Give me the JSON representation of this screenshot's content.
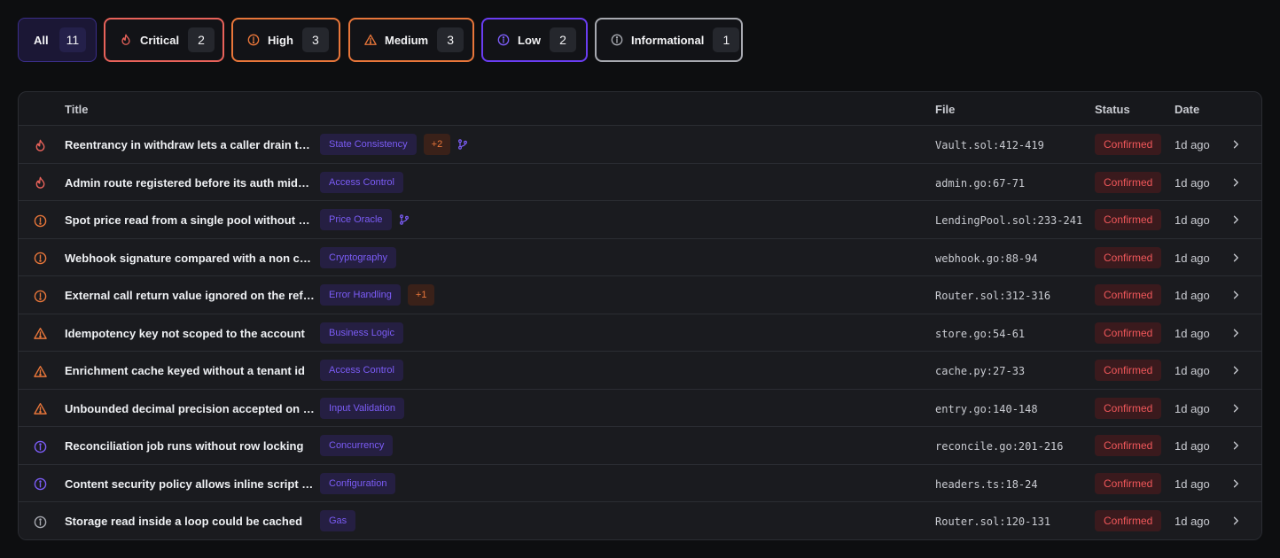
{
  "filters": {
    "all": {
      "label": "All",
      "count": "11"
    },
    "critical": {
      "label": "Critical",
      "count": "2",
      "icon": "flame-icon",
      "color": "#e8625a"
    },
    "high": {
      "label": "High",
      "count": "3",
      "icon": "alert-circle-icon",
      "color": "#e8763a"
    },
    "medium": {
      "label": "Medium",
      "count": "3",
      "icon": "warning-triangle-icon",
      "color": "#e8763a"
    },
    "low": {
      "label": "Low",
      "count": "2",
      "icon": "info-circle-icon",
      "color": "#6a3df2"
    },
    "informational": {
      "label": "Informational",
      "count": "1",
      "icon": "info-circle-icon",
      "color": "#a7a9b0"
    }
  },
  "table": {
    "headers": {
      "title": "Title",
      "file": "File",
      "status": "Status",
      "date": "Date"
    },
    "rows": [
      {
        "severity": "critical",
        "title": "Reentrancy in withdraw lets a caller drain the vault",
        "tag": "State Consistency",
        "extra": "+2",
        "branch": true,
        "file": "Vault.sol:412-419",
        "status": "Confirmed",
        "date": "1d ago"
      },
      {
        "severity": "critical",
        "title": "Admin route registered before its auth middleware",
        "tag": "Access Control",
        "extra": "",
        "branch": false,
        "file": "admin.go:67-71",
        "status": "Confirmed",
        "date": "1d ago"
      },
      {
        "severity": "high",
        "title": "Spot price read from a single pool without a TWAP",
        "tag": "Price Oracle",
        "extra": "",
        "branch": true,
        "file": "LendingPool.sol:233-241",
        "status": "Confirmed",
        "date": "1d ago"
      },
      {
        "severity": "high",
        "title": "Webhook signature compared with a non constant-time check",
        "tag": "Cryptography",
        "extra": "",
        "branch": false,
        "file": "webhook.go:88-94",
        "status": "Confirmed",
        "date": "1d ago"
      },
      {
        "severity": "high",
        "title": "External call return value ignored on the refund path",
        "tag": "Error Handling",
        "extra": "+1",
        "branch": false,
        "file": "Router.sol:312-316",
        "status": "Confirmed",
        "date": "1d ago"
      },
      {
        "severity": "medium",
        "title": "Idempotency key not scoped to the account",
        "tag": "Business Logic",
        "extra": "",
        "branch": false,
        "file": "store.go:54-61",
        "status": "Confirmed",
        "date": "1d ago"
      },
      {
        "severity": "medium",
        "title": "Enrichment cache keyed without a tenant id",
        "tag": "Access Control",
        "extra": "",
        "branch": false,
        "file": "cache.py:27-33",
        "status": "Confirmed",
        "date": "1d ago"
      },
      {
        "severity": "medium",
        "title": "Unbounded decimal precision accepted on a journal entry",
        "tag": "Input Validation",
        "extra": "",
        "branch": false,
        "file": "entry.go:140-148",
        "status": "Confirmed",
        "date": "1d ago"
      },
      {
        "severity": "low",
        "title": "Reconciliation job runs without row locking",
        "tag": "Concurrency",
        "extra": "",
        "branch": false,
        "file": "reconcile.go:201-216",
        "status": "Confirmed",
        "date": "1d ago"
      },
      {
        "severity": "low",
        "title": "Content security policy allows inline script in the dashboard",
        "tag": "Configuration",
        "extra": "",
        "branch": false,
        "file": "headers.ts:18-24",
        "status": "Confirmed",
        "date": "1d ago"
      },
      {
        "severity": "informational",
        "title": "Storage read inside a loop could be cached",
        "tag": "Gas",
        "extra": "",
        "branch": false,
        "file": "Router.sol:120-131",
        "status": "Confirmed",
        "date": "1d ago"
      }
    ]
  }
}
